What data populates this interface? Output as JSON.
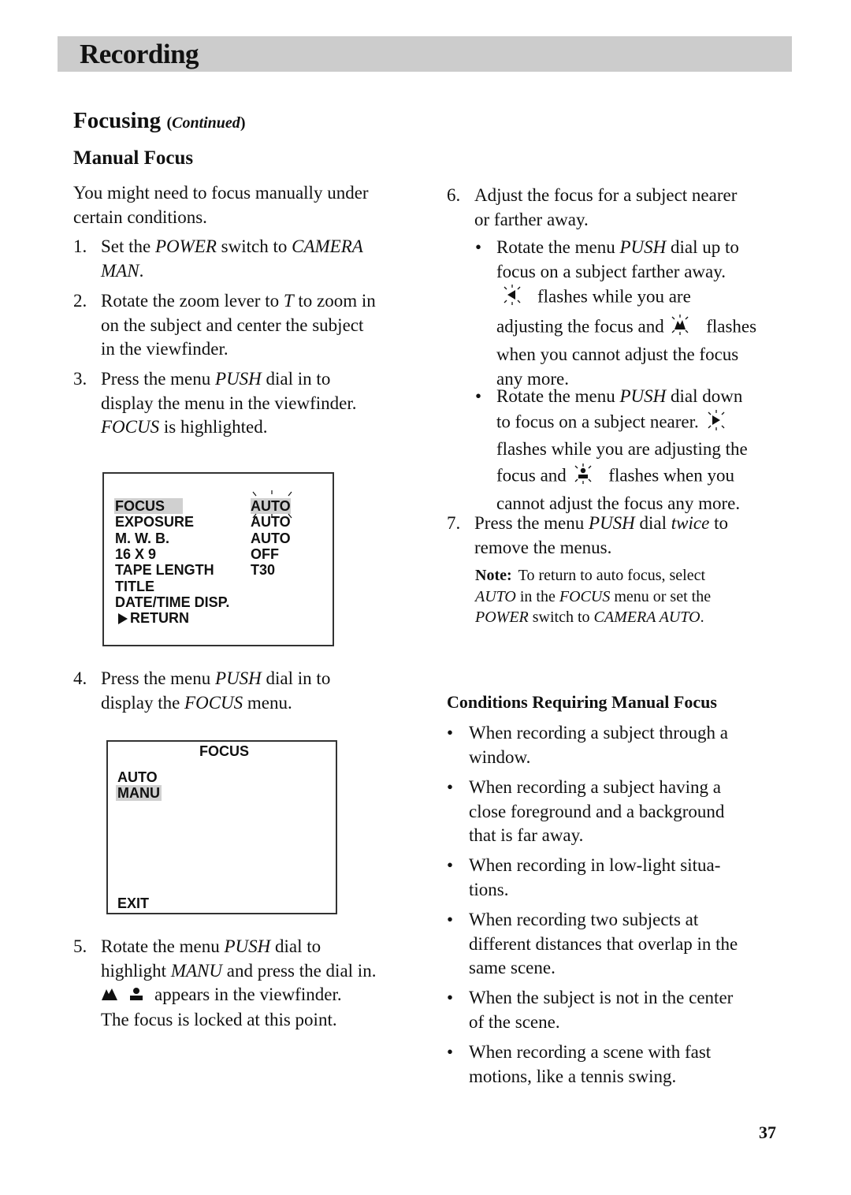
{
  "header": {
    "title": "Recording",
    "bar_color": "#cccccc"
  },
  "section": {
    "title": "Focusing",
    "paren_open": "(",
    "continued": "Continued",
    "paren_close": ")"
  },
  "manual_focus": {
    "title": "Manual Focus",
    "intro": "You might need to focus manually under certain conditions.",
    "intro_lines": [
      "You might need to focus manually under",
      "certain conditions."
    ],
    "steps": [
      {
        "num": "1.",
        "lines": [
          [
            {
              "t": "Set the "
            },
            {
              "t": "POWER",
              "i": true
            },
            {
              "t": " switch to "
            },
            {
              "t": "CAMERA",
              "i": true
            }
          ],
          [
            {
              "t": "MAN",
              "i": true
            },
            {
              "t": "."
            }
          ]
        ]
      },
      {
        "num": "2.",
        "lines": [
          [
            {
              "t": "Rotate the zoom lever to "
            },
            {
              "t": "T",
              "i": true
            },
            {
              "t": " to zoom in"
            }
          ],
          [
            {
              "t": "on the subject and center the subject"
            }
          ],
          [
            {
              "t": "in the viewfinder."
            }
          ]
        ]
      },
      {
        "num": "3.",
        "lines": [
          [
            {
              "t": "Press the menu "
            },
            {
              "t": "PUSH",
              "i": true
            },
            {
              "t": " dial in to"
            }
          ],
          [
            {
              "t": "display the menu in the viewfinder."
            }
          ],
          [
            {
              "t": "FOCUS",
              "i": true
            },
            {
              "t": " is highlighted."
            }
          ]
        ]
      },
      {
        "num": "4.",
        "lines": [
          [
            {
              "t": "Press the menu "
            },
            {
              "t": "PUSH",
              "i": true
            },
            {
              "t": " dial in to"
            }
          ],
          [
            {
              "t": "display the "
            },
            {
              "t": "FOCUS",
              "i": true
            },
            {
              "t": " menu."
            }
          ]
        ]
      },
      {
        "num": "5.",
        "lines": [
          [
            {
              "t": "Rotate the menu "
            },
            {
              "t": "PUSH",
              "i": true
            },
            {
              "t": " dial to"
            }
          ],
          [
            {
              "t": "highlight "
            },
            {
              "t": "MANU",
              "i": true
            },
            {
              "t": " and press the dial in."
            }
          ],
          [
            {
              "icon": "mountain-icon"
            },
            {
              "icon": "person-icon"
            },
            {
              "t": "appears in the viewfinder."
            }
          ],
          [
            {
              "t": "The focus is locked at this point."
            }
          ]
        ]
      },
      {
        "num": "6.",
        "lines": [
          [
            {
              "t": "Adjust the focus for a subject nearer"
            }
          ],
          [
            {
              "t": "or farther away."
            }
          ]
        ]
      },
      {
        "num": "7.",
        "lines": [
          [
            {
              "t": "Press the menu "
            },
            {
              "t": "PUSH",
              "i": true
            },
            {
              "t": " dial "
            },
            {
              "t": "twice",
              "i": true
            },
            {
              "t": " to"
            }
          ],
          [
            {
              "t": "remove the menus."
            }
          ]
        ]
      }
    ],
    "step6_bullets": [
      {
        "lines": [
          [
            {
              "t": "Rotate the menu "
            },
            {
              "t": "PUSH",
              "i": true
            },
            {
              "t": " dial up to"
            }
          ],
          [
            {
              "t": "focus on a subject farther away."
            }
          ],
          [
            {
              "icon": "flashing-far-arrow-icon"
            },
            {
              "t": "flashes while you are"
            }
          ],
          [
            {
              "t": "adjusting the focus and "
            },
            {
              "icon": "flashing-mountain-icon"
            },
            {
              "t": " flashes"
            }
          ],
          [
            {
              "t": "when you cannot adjust the focus"
            }
          ],
          [
            {
              "t": "any more."
            }
          ]
        ]
      },
      {
        "lines": [
          [
            {
              "t": "Rotate the menu "
            },
            {
              "t": "PUSH",
              "i": true
            },
            {
              "t": " dial down"
            }
          ],
          [
            {
              "t": "to focus on a subject nearer. "
            },
            {
              "icon": "flashing-near-arrow-icon"
            }
          ],
          [
            {
              "t": "flashes while you are adjusting the"
            }
          ],
          [
            {
              "t": "focus and "
            },
            {
              "icon": "flashing-person-icon"
            },
            {
              "t": " flashes when you"
            }
          ],
          [
            {
              "t": "cannot adjust the focus any more."
            }
          ]
        ]
      }
    ],
    "note": {
      "label": "Note:",
      "lines": [
        [
          {
            "t": "To return to auto focus, select"
          }
        ],
        [
          {
            "t": "AUTO",
            "i": true
          },
          {
            "t": " in the "
          },
          {
            "t": "FOCUS",
            "i": true
          },
          {
            "t": " menu or set the"
          }
        ],
        [
          {
            "t": "POWER",
            "i": true
          },
          {
            "t": " switch to "
          },
          {
            "t": "CAMERA AUTO",
            "i": true
          },
          {
            "t": "."
          }
        ]
      ]
    }
  },
  "main_menu": {
    "items": [
      {
        "label": "FOCUS",
        "value": "AUTO",
        "highlighted": true
      },
      {
        "label": "EXPOSURE",
        "value": "AUTO"
      },
      {
        "label": "M. W. B.",
        "value": "AUTO"
      },
      {
        "label": "16 X 9",
        "value": "OFF"
      },
      {
        "label": "TAPE LENGTH",
        "value": "T30"
      },
      {
        "label": "TITLE",
        "value": ""
      },
      {
        "label": "DATE/TIME DISP.",
        "value": ""
      },
      {
        "label": "RETURN",
        "value": "",
        "arrow": true
      }
    ]
  },
  "focus_menu": {
    "title": "FOCUS",
    "options": [
      {
        "label": "AUTO",
        "highlighted": false
      },
      {
        "label": "MANU",
        "highlighted": true
      }
    ],
    "exit_label": "EXIT"
  },
  "conditions": {
    "title": "Conditions Requiring Manual Focus",
    "items": [
      {
        "lines": [
          "When recording a subject through a",
          "window."
        ]
      },
      {
        "lines": [
          "When recording a subject having a",
          "close foreground and a background",
          "that is far away."
        ]
      },
      {
        "lines": [
          "When recording in low-light situa-",
          "tions."
        ]
      },
      {
        "lines": [
          "When recording two subjects at",
          "different distances that overlap in the",
          "same scene."
        ]
      },
      {
        "lines": [
          "When the subject is not in the center",
          "of the scene."
        ]
      },
      {
        "lines": [
          "When recording a scene with fast",
          "motions, like a tennis swing."
        ]
      }
    ]
  },
  "page_number": "37",
  "highlight_color": "#d0d0d0"
}
